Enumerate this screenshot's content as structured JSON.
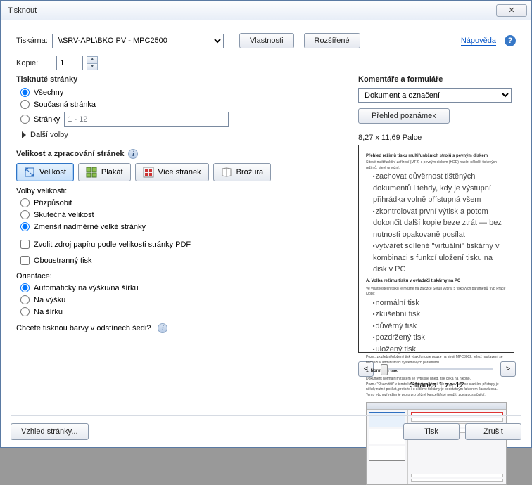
{
  "window": {
    "title": "Tisknout",
    "close_glyph": "✕"
  },
  "header": {
    "printer_label": "Tiskárna:",
    "printer_value": "\\\\SRV-APL\\BKO PV - MPC2500",
    "properties_btn": "Vlastnosti",
    "advanced_btn": "Rozšířené",
    "help_link": "Nápověda",
    "copies_label": "Kopie:",
    "copies_value": "1"
  },
  "pages": {
    "title": "Tisknuté stránky",
    "all": "Všechny",
    "current": "Současná stránka",
    "range_label": "Stránky",
    "range_value": "1 - 12",
    "more": "Další volby"
  },
  "sizing": {
    "title": "Velikost a zpracování stránek",
    "btn_size": "Velikost",
    "btn_poster": "Plakát",
    "btn_multi": "Více stránek",
    "btn_booklet": "Brožura",
    "options_label": "Volby velikosti:",
    "fit": "Přizpůsobit",
    "actual": "Skutečná velikost",
    "shrink": "Zmenšit nadměrně velké stránky",
    "paper_source": "Zvolit zdroj papíru podle velikosti stránky PDF",
    "duplex": "Oboustranný tisk"
  },
  "orientation": {
    "title": "Orientace:",
    "auto": "Automaticky na výšku/na šířku",
    "portrait": "Na výšku",
    "landscape": "Na šířku"
  },
  "grayscale_q": "Chcete tisknou barvy v odstínech šedi?",
  "comments": {
    "title": "Komentáře a formuláře",
    "select_value": "Dokument a označení",
    "notes_btn": "Přehled poznámek"
  },
  "preview": {
    "dims": "8,27 x 11,69 Palce",
    "doc_title": "Přehled režimů tisku multifunkčních strojů s pevným diskem",
    "sectA": "A. Volba režimu tisku v ovladači tiskárny na PC",
    "sect1": "1.  Normální tisk",
    "page_of": "Stránka 1 ze 12",
    "prev_glyph": "<",
    "next_glyph": ">"
  },
  "footer": {
    "page_setup": "Vzhled stránky...",
    "print": "Tisk",
    "cancel": "Zrušit"
  }
}
